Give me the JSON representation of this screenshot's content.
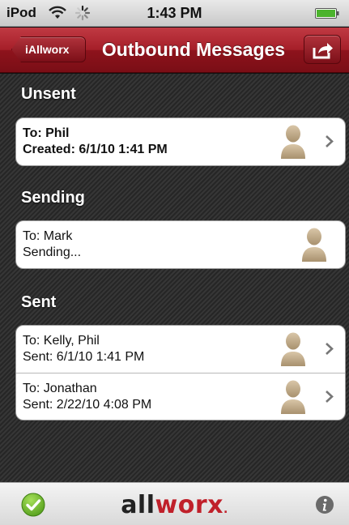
{
  "status_bar": {
    "carrier": "iPod",
    "time": "1:43 PM"
  },
  "nav_bar": {
    "back_label": "iAllworx",
    "title": "Outbound Messages",
    "action_icon": "share-icon"
  },
  "sections": {
    "unsent": {
      "header": "Unsent",
      "rows": [
        {
          "line1": "To: Phil",
          "line2": "Created: 6/1/10 1:41 PM"
        }
      ]
    },
    "sending": {
      "header": "Sending",
      "rows": [
        {
          "line1": "To: Mark",
          "line2": "Sending..."
        }
      ]
    },
    "sent": {
      "header": "Sent",
      "rows": [
        {
          "line1": "To: Kelly, Phil",
          "line2": "Sent: 6/1/10 1:41 PM"
        },
        {
          "line1": "To: Jonathan",
          "line2": "Sent: 2/22/10 4:08 PM"
        }
      ]
    }
  },
  "bottom_bar": {
    "logo_part1": "all",
    "logo_part2": "worx",
    "logo_suffix": ".",
    "accent_color": "#c0202a",
    "check_color": "#6dbd2b"
  },
  "colors": {
    "nav_red": "#a51e28",
    "background": "#2f2f2f"
  }
}
